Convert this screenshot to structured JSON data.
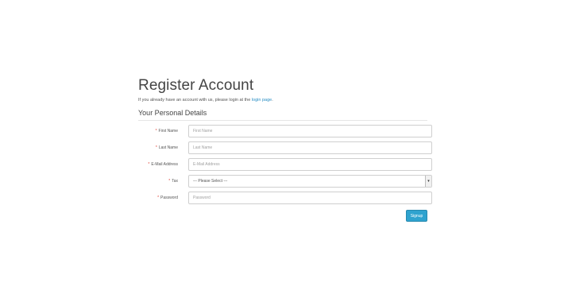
{
  "page": {
    "title": "Register Account",
    "intro_text": "If you already have an account with us, please login at the ",
    "intro_link": "login page",
    "intro_end": "."
  },
  "section": {
    "legend": "Your Personal Details"
  },
  "form": {
    "required_marker": "*",
    "fields": [
      {
        "label": "First Name",
        "placeholder": "First Name"
      },
      {
        "label": "Last Name",
        "placeholder": "Last Name"
      },
      {
        "label": "E-Mail Address",
        "placeholder": "E-Mail Address"
      },
      {
        "label": "Tax",
        "selected": "--- Please Select ---"
      },
      {
        "label": "Password",
        "placeholder": "Password"
      }
    ],
    "select_arrow": "▾",
    "submit_label": "Signup"
  },
  "colors": {
    "accent": "#2fa3cf",
    "link": "#2a8ec4",
    "required": "#e03c31"
  }
}
